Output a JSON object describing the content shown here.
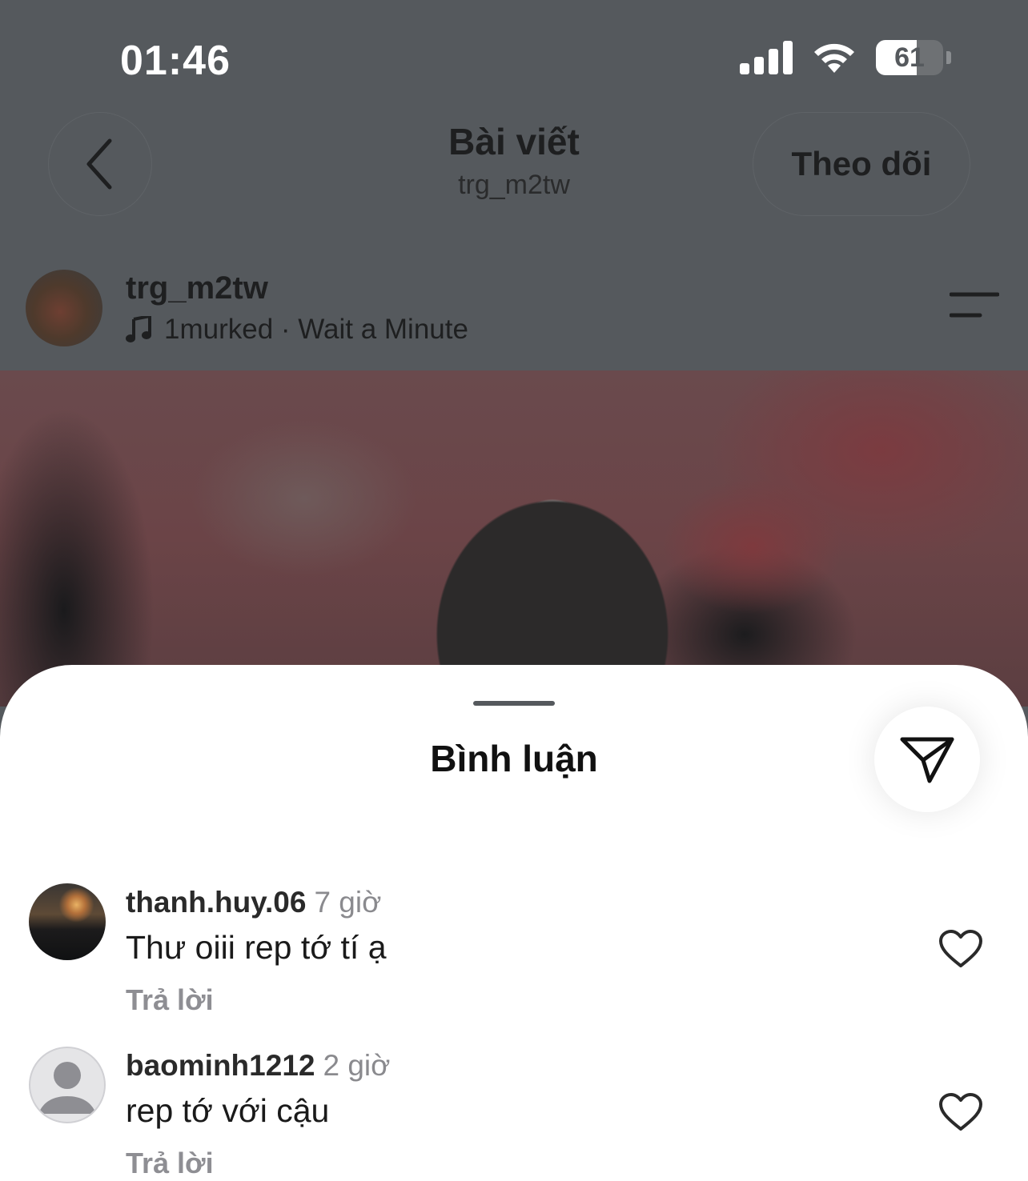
{
  "status_bar": {
    "time": "01:46",
    "battery": "61"
  },
  "nav": {
    "title": "Bài viết",
    "subtitle": "trg_m2tw",
    "follow_label": "Theo dõi"
  },
  "post": {
    "username": "trg_m2tw",
    "music": "1murked · Wait a Minute"
  },
  "sheet": {
    "title": "Bình luận"
  },
  "comments": [
    {
      "username": "thanh.huy.06",
      "time": "7 giờ",
      "text": "Thư oiii rep tớ tí ạ",
      "reply_label": "Trả lời"
    },
    {
      "username": "baominh1212",
      "time": "2 giờ",
      "text": "rep tớ với cậu",
      "reply_label": "Trả lời"
    }
  ]
}
